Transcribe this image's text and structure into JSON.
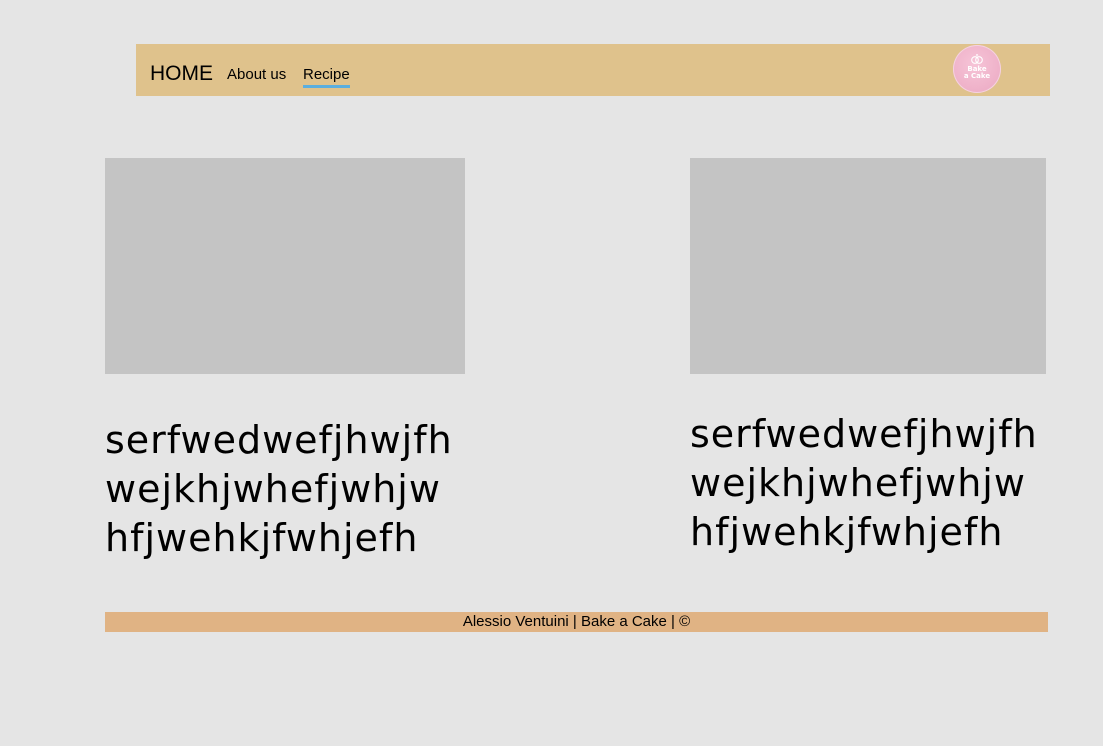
{
  "nav": {
    "home": "HOME",
    "about": "About us",
    "recipe": "Recipe",
    "logo": {
      "line1": "Bake",
      "line2": "a Cake",
      "icon": "rings-icon"
    }
  },
  "cards": [
    {
      "text": "serfwedwefjhwjfh\nwejkhjwhefjwhjw\nhfjwehkjfwhjefh"
    },
    {
      "text": "serfwedwefjhwjfh\nwejkhjwhefjwhjw\nhfjwehkjfwhjefh"
    }
  ],
  "footer": {
    "text": "Alessio Ventuini | Bake a Cake | ©"
  },
  "colors": {
    "background": "#e5e5e5",
    "navbar": "#dfc28c",
    "footer": "#e0b384",
    "image_placeholder": "#c4c4c4",
    "active_underline": "#5aaedf",
    "logo": "#eeb0c8"
  }
}
